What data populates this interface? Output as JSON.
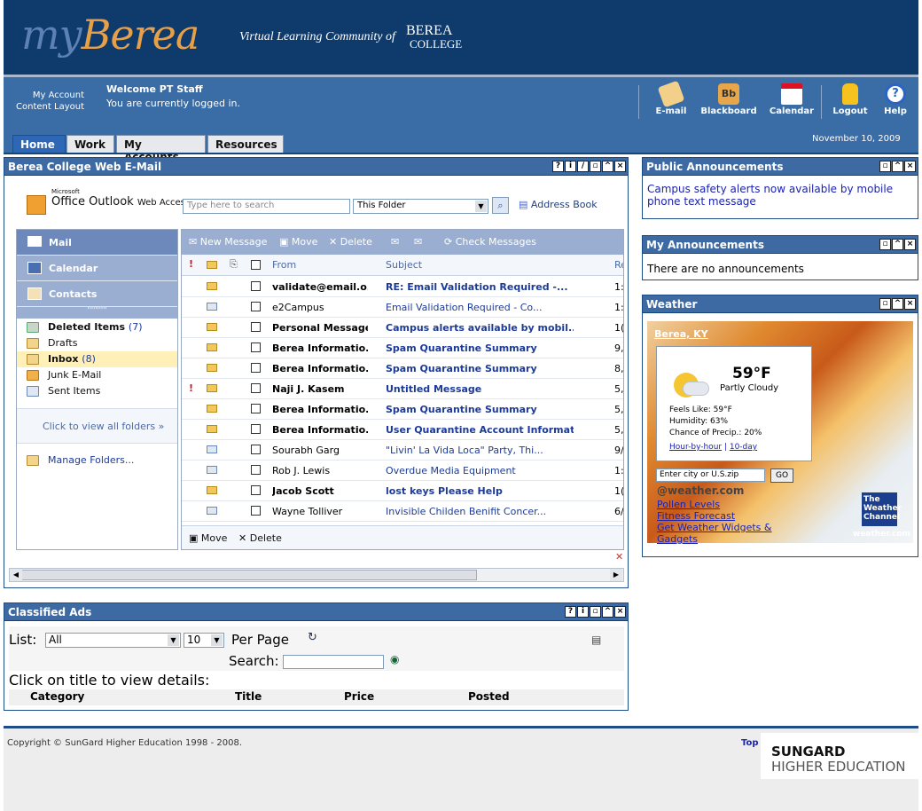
{
  "banner": {
    "logo_my": "my",
    "logo_berea": "Berea",
    "tagline": "Virtual Learning Community of",
    "college_line1": "BEREA",
    "college_line2": "COLLEGE"
  },
  "account": {
    "my_account": "My Account",
    "content_layout": "Content Layout",
    "welcome": "Welcome PT Staff",
    "status": "You are currently logged in."
  },
  "nav_icons": [
    {
      "label": "E-mail",
      "icon": "envelope-icon"
    },
    {
      "label": "Blackboard",
      "icon": "blackboard-icon"
    },
    {
      "label": "Calendar",
      "icon": "calendar-icon"
    },
    {
      "label": "Logout",
      "icon": "lock-icon"
    },
    {
      "label": "Help",
      "icon": "help-icon"
    }
  ],
  "date": "November 10, 2009",
  "tabs": [
    {
      "label": "Home",
      "active": true
    },
    {
      "label": "Work"
    },
    {
      "label": "My Accounts"
    },
    {
      "label": "Resources"
    }
  ],
  "email_panel": {
    "title": "Berea College Web E-Mail",
    "owa_ms": "Microsoft",
    "owa_name": "Office Outlook",
    "owa_sub": "Web Access",
    "search_placeholder": "Type here to search",
    "folder_value": "This Folder",
    "address_book": "Address Book",
    "nav": {
      "mail": "Mail",
      "calendar": "Calendar",
      "contacts": "Contacts"
    },
    "folders": [
      {
        "name": "Deleted Items",
        "count": "(7)"
      },
      {
        "name": "Drafts",
        "count": ""
      },
      {
        "name": "Inbox",
        "count": "(8)"
      },
      {
        "name": "Junk E-Mail",
        "count": ""
      },
      {
        "name": "Sent Items",
        "count": ""
      }
    ],
    "view_all": "Click to view all folders",
    "manage": "Manage Folders...",
    "toolbar": {
      "new_message": "New Message",
      "move": "Move",
      "delete": "Delete",
      "check": "Check Messages"
    },
    "columns": {
      "from": "From",
      "subject": "Subject",
      "received": "Re"
    },
    "messages": [
      {
        "from": "validate@email.o...",
        "subject": "RE: Email Validation Required -...",
        "rcv": "1:",
        "unread": true,
        "important": false,
        "read_icon": false
      },
      {
        "from": "e2Campus",
        "subject": "Email Validation Required - Co...",
        "rcv": "1:",
        "unread": false,
        "important": false,
        "read_icon": true
      },
      {
        "from": "Personal Message",
        "subject": "Campus alerts available by mobil...",
        "rcv": "1(",
        "unread": true,
        "important": false,
        "read_icon": false
      },
      {
        "from": "Berea Informatio...",
        "subject": "Spam Quarantine Summary",
        "rcv": "9,",
        "unread": true,
        "important": false,
        "read_icon": false
      },
      {
        "from": "Berea Informatio...",
        "subject": "Spam Quarantine Summary",
        "rcv": "8,",
        "unread": true,
        "important": false,
        "read_icon": false
      },
      {
        "from": "Naji J. Kasem",
        "subject": "Untitled Message",
        "rcv": "5,",
        "unread": true,
        "important": true,
        "read_icon": false
      },
      {
        "from": "Berea Informatio...",
        "subject": "Spam Quarantine Summary",
        "rcv": "5,",
        "unread": true,
        "important": false,
        "read_icon": false
      },
      {
        "from": "Berea Informatio...",
        "subject": "User Quarantine Account Informat...",
        "rcv": "5,",
        "unread": true,
        "important": false,
        "read_icon": false
      },
      {
        "from": "Sourabh Garg",
        "subject": "\"Livin' La Vida Loca\" Party, Thi...",
        "rcv": "9/",
        "unread": false,
        "important": false,
        "read_icon": true
      },
      {
        "from": "Rob J. Lewis",
        "subject": "Overdue Media Equipment",
        "rcv": "1:",
        "unread": false,
        "important": false,
        "read_icon": true
      },
      {
        "from": "Jacob Scott",
        "subject": "lost keys Please Help",
        "rcv": "1(",
        "unread": true,
        "important": false,
        "read_icon": false
      },
      {
        "from": "Wayne Tolliver",
        "subject": "Invisible Childen Benifit Concer...",
        "rcv": "6/",
        "unread": false,
        "important": false,
        "read_icon": true
      }
    ],
    "bottom_move": "Move",
    "bottom_delete": "Delete"
  },
  "public_announcements": {
    "title": "Public Announcements",
    "text": "Campus safety alerts now available by mobile phone text message"
  },
  "my_announcements": {
    "title": "My Announcements",
    "text": "There are no announcements"
  },
  "weather": {
    "title": "Weather",
    "city": "Berea, KY",
    "temp": "59°F",
    "condition": "Partly Cloudy",
    "feels": "Feels Like: 59°F",
    "humidity": "Humidity: 63%",
    "precip": "Chance of Precip.: 20%",
    "hourly": "Hour-by-hour",
    "tenday": "10-day",
    "input_placeholder": "Enter city or U.S.zip",
    "go": "GO",
    "at_weather": "@weather.com",
    "links": [
      "Pollen Levels",
      "Fitness Forecast",
      "Get Weather Widgets & Gadgets"
    ],
    "twc_1": "The",
    "twc_2": "Weather",
    "twc_3": "Channel",
    "twc_url": "weather.com"
  },
  "classified": {
    "title": "Classified Ads",
    "list_label": "List:",
    "list_value": "All",
    "per_page_value": "10",
    "per_page_label": "Per Page",
    "search_label": "Search:",
    "hint": "Click on title to view details:",
    "columns": [
      "Category",
      "Title",
      "Price",
      "Posted"
    ]
  },
  "footer": {
    "copyright": "Copyright © SunGard Higher Education 1998 - 2008.",
    "top": "Top",
    "brand1": "SUNGARD",
    "brand2": "HIGHER EDUCATION"
  },
  "colors": {
    "banner": "#0e3a6c",
    "navbar": "#3a6ca6",
    "panel_header": "#3d6aa3",
    "link": "#1a23b3"
  }
}
